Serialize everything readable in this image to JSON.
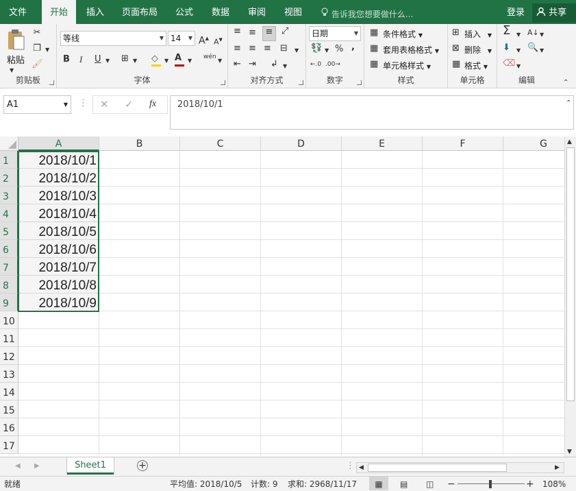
{
  "tabs": [
    {
      "label": "文件",
      "active": false
    },
    {
      "label": "开始",
      "active": true
    },
    {
      "label": "插入",
      "active": false
    },
    {
      "label": "页面布局",
      "active": false
    },
    {
      "label": "公式",
      "active": false
    },
    {
      "label": "数据",
      "active": false
    },
    {
      "label": "审阅",
      "active": false
    },
    {
      "label": "视图",
      "active": false
    }
  ],
  "tellme_placeholder": "告诉我您想要做什么...",
  "login_label": "登录",
  "share_label": "共享",
  "ribbon": {
    "clipboard": {
      "label": "剪贴板",
      "paste": "粘贴"
    },
    "font": {
      "label": "字体",
      "name": "等线",
      "size": "14",
      "bold": "B",
      "italic": "I",
      "underline": "U",
      "phonetic": "wén"
    },
    "alignment": {
      "label": "对齐方式"
    },
    "number": {
      "label": "数字",
      "format": "日期",
      "percent": "%",
      "comma": ","
    },
    "styles": {
      "label": "样式",
      "conditional": "条件格式",
      "table": "套用表格格式",
      "cell": "单元格样式"
    },
    "cells": {
      "label": "单元格",
      "insert": "插入",
      "delete": "删除",
      "format": "格式"
    },
    "editing": {
      "label": "编辑"
    }
  },
  "formula_bar": {
    "name_box": "A1",
    "fx": "fx",
    "formula": "2018/10/1"
  },
  "columns": [
    "A",
    "B",
    "C",
    "D",
    "E",
    "F",
    "G"
  ],
  "rows": [
    "1",
    "2",
    "3",
    "4",
    "5",
    "6",
    "7",
    "8",
    "9",
    "10",
    "11",
    "12",
    "13",
    "14",
    "15",
    "16",
    "17"
  ],
  "cells_A": [
    "2018/10/1",
    "2018/10/2",
    "2018/10/3",
    "2018/10/4",
    "2018/10/5",
    "2018/10/6",
    "2018/10/7",
    "2018/10/8",
    "2018/10/9"
  ],
  "sheet_tab": "Sheet1",
  "status": {
    "ready": "就绪",
    "average": "平均值: 2018/10/5",
    "count": "计数: 9",
    "sum": "求和: 2968/11/17",
    "zoom": "108%"
  },
  "colors": {
    "accent": "#217346"
  }
}
